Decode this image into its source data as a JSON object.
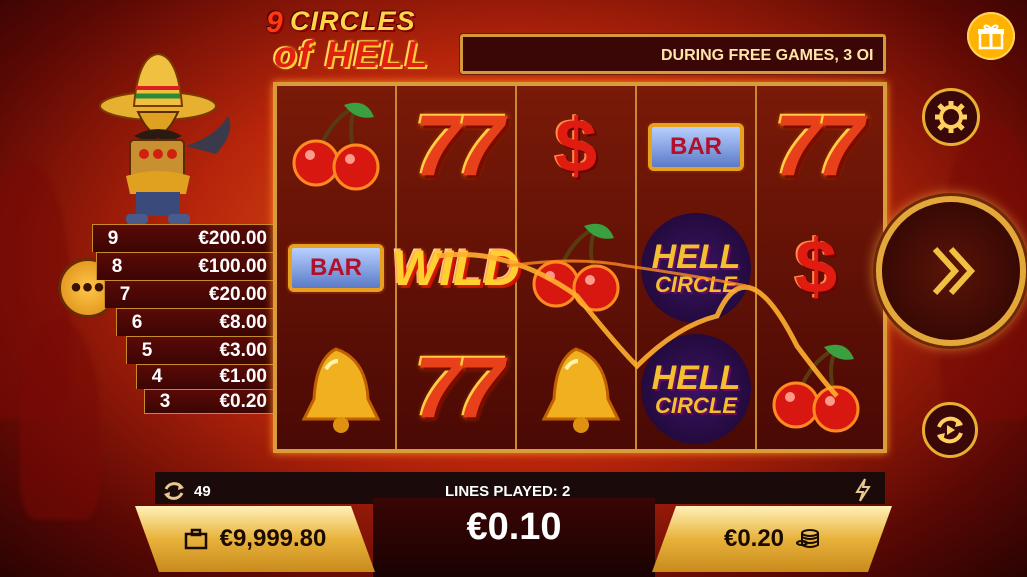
{
  "game": {
    "logo_line1": "CIRCLES",
    "logo_line2": "of HELL",
    "logo_nine": "9"
  },
  "marquee": {
    "text": "DURING FREE GAMES, 3 OI"
  },
  "paytable": {
    "rows": [
      {
        "count": "9",
        "amount": "€200.00"
      },
      {
        "count": "8",
        "amount": "€100.00"
      },
      {
        "count": "7",
        "amount": "€20.00"
      },
      {
        "count": "6",
        "amount": "€8.00"
      },
      {
        "count": "5",
        "amount": "€3.00"
      },
      {
        "count": "4",
        "amount": "€1.00"
      },
      {
        "count": "3",
        "amount": "€0.20"
      }
    ]
  },
  "reels": {
    "symbols": [
      [
        "cherries",
        "bar",
        "bell"
      ],
      [
        "seven",
        "wild",
        "seven"
      ],
      [
        "dollar",
        "cherries",
        "bell"
      ],
      [
        "bar",
        "hell-circle",
        "hell-circle"
      ],
      [
        "seven",
        "dollar",
        "cherries"
      ]
    ],
    "labels": {
      "bar": "BAR",
      "wild": "WILD",
      "hell_top": "HELL",
      "hell_bottom": "CIRCLE",
      "seven": "7",
      "dollar": "$"
    }
  },
  "status": {
    "autoplay_rounds": "49",
    "lines_played": "LINES PLAYED: 2",
    "win": "€0.10",
    "balance": "€9,999.80",
    "bet": "€0.20"
  },
  "icons": {
    "gift": "gift-icon",
    "menu": "more-dots-icon",
    "settings": "gear-icon",
    "spin": "double-chevron-right-icon",
    "autoplay": "autoplay-icon",
    "turbo": "lightning-icon",
    "balance": "briefcase-icon",
    "bet": "coins-icon",
    "rounds": "refresh-icon"
  },
  "colors": {
    "gold": "#e4a83a",
    "dark_red": "#3a0606",
    "win_line": "#ffb030"
  }
}
